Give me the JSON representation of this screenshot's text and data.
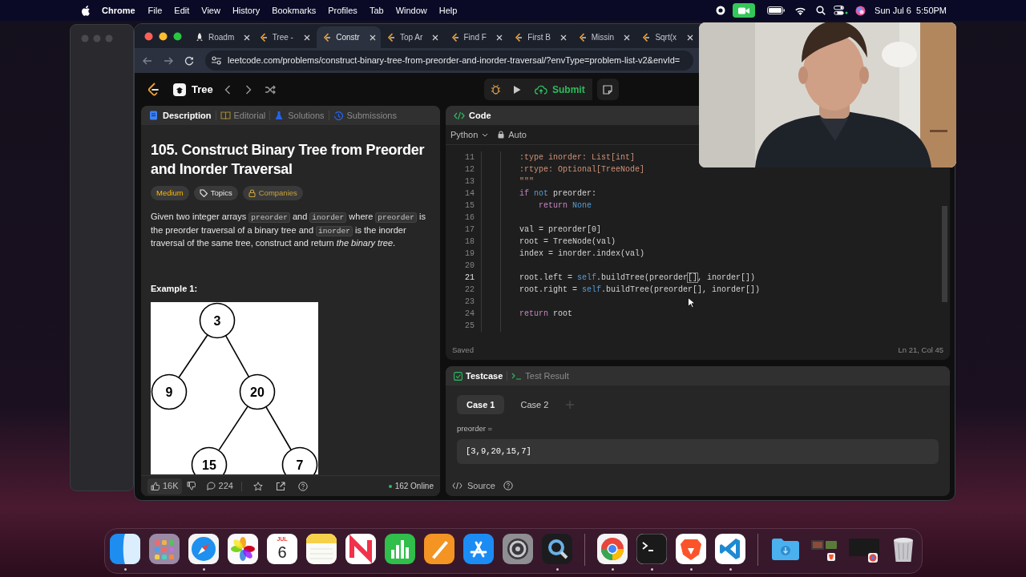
{
  "menu_bar": {
    "app": "Chrome",
    "menus": [
      "File",
      "Edit",
      "View",
      "History",
      "Bookmarks",
      "Profiles",
      "Tab",
      "Window",
      "Help"
    ],
    "clock": "Sun Jul 6  5:50PM"
  },
  "browser": {
    "tabs": [
      {
        "title": "Roadm",
        "selected": false,
        "kind": "rocket"
      },
      {
        "title": "Tree -",
        "selected": false,
        "kind": "leetcode"
      },
      {
        "title": "Constr",
        "selected": true,
        "kind": "leetcode"
      },
      {
        "title": "Top Ar",
        "selected": false,
        "kind": "leetcode"
      },
      {
        "title": "Find F",
        "selected": false,
        "kind": "leetcode"
      },
      {
        "title": "First B",
        "selected": false,
        "kind": "leetcode"
      },
      {
        "title": "Missin",
        "selected": false,
        "kind": "leetcode"
      },
      {
        "title": "Sqrt(x",
        "selected": false,
        "kind": "leetcode"
      }
    ],
    "url": "leetcode.com/problems/construct-binary-tree-from-preorder-and-inorder-traversal/?envType=problem-list-v2&envId="
  },
  "nav": {
    "list_title": "Tree",
    "submit": "Submit"
  },
  "description_panel": {
    "tabs": [
      {
        "label": "Description",
        "selected": true,
        "kind": "description"
      },
      {
        "label": "Editorial",
        "selected": false,
        "kind": "editorial"
      },
      {
        "label": "Solutions",
        "selected": false,
        "kind": "solutions"
      },
      {
        "label": "Submissions",
        "selected": false,
        "kind": "submissions"
      }
    ],
    "title": "105. Construct Binary Tree from Preorder and Inorder Traversal",
    "tags": [
      {
        "label": "Medium",
        "kind": "difficulty"
      },
      {
        "label": "Topics",
        "kind": "topics"
      },
      {
        "label": "Companies",
        "kind": "companies"
      }
    ],
    "statement": [
      {
        "text": "Given two integer arrays ",
        "kind": "text"
      },
      {
        "text": "preorder",
        "kind": "code"
      },
      {
        "text": " and ",
        "kind": "text"
      },
      {
        "text": "inorder",
        "kind": "code"
      },
      {
        "text": " where ",
        "kind": "text"
      },
      {
        "text": "preorder",
        "kind": "code"
      },
      {
        "text": " is the preorder traversal of a binary tree and ",
        "kind": "text"
      },
      {
        "text": "inorder",
        "kind": "code"
      },
      {
        "text": " is the inorder traversal of the same tree, construct and return *the binary tree*.",
        "kind": "text"
      }
    ],
    "example_heading": "Example 1:",
    "tree_nodes": [
      "3",
      "9",
      "20",
      "15",
      "7"
    ],
    "likes": "16K",
    "comments": "224",
    "online": "162 Online"
  },
  "code_panel": {
    "title": "Code",
    "language": "Python",
    "mode": "Auto",
    "lines": [
      {
        "number": "11",
        "active": false,
        "tokens": [
          {
            "text": "        :type inorder: List[int]",
            "kind": "doc"
          }
        ]
      },
      {
        "number": "12",
        "active": false,
        "tokens": [
          {
            "text": "        :rtype: Optional[TreeNode]",
            "kind": "doc"
          }
        ]
      },
      {
        "number": "13",
        "active": false,
        "tokens": [
          {
            "text": "        \"\"\"",
            "kind": "doc"
          }
        ]
      },
      {
        "number": "14",
        "active": false,
        "tokens": [
          {
            "text": "        if",
            "kind": "ctrl"
          },
          {
            "text": " not",
            "kind": "kw"
          },
          {
            "text": " preorder:",
            "kind": "plain"
          }
        ]
      },
      {
        "number": "15",
        "active": false,
        "tokens": [
          {
            "text": "            return",
            "kind": "ctrl"
          },
          {
            "text": " None",
            "kind": "kw"
          }
        ]
      },
      {
        "number": "16",
        "active": false
      },
      {
        "number": "17",
        "active": false,
        "tokens": [
          {
            "text": "        val = preorder[0]",
            "kind": "plain"
          }
        ]
      },
      {
        "number": "18",
        "active": false,
        "tokens": [
          {
            "text": "        root = TreeNode(val)",
            "kind": "plain"
          }
        ]
      },
      {
        "number": "19",
        "active": false,
        "tokens": [
          {
            "text": "        index = inorder.index(val)",
            "kind": "plain"
          }
        ]
      },
      {
        "number": "20",
        "active": false
      },
      {
        "number": "21",
        "active": true,
        "tokens": [
          {
            "text": "        root.left =",
            "kind": "plain"
          },
          {
            "text": " self",
            "kind": "kw"
          },
          {
            "text": ".buildTree(preorder",
            "kind": "plain"
          },
          {
            "text": "[]",
            "kind": "match"
          },
          {
            "text": ", inorder[])",
            "kind": "plain"
          }
        ]
      },
      {
        "number": "22",
        "active": false,
        "tokens": [
          {
            "text": "        root.right =",
            "kind": "plain"
          },
          {
            "text": " self",
            "kind": "kw"
          },
          {
            "text": ".buildTree(preorder[], inorder[])",
            "kind": "plain"
          }
        ]
      },
      {
        "number": "23",
        "active": false
      },
      {
        "number": "24",
        "active": false,
        "tokens": [
          {
            "text": "        return",
            "kind": "ctrl"
          },
          {
            "text": " root",
            "kind": "plain"
          }
        ]
      },
      {
        "number": "25",
        "active": false
      }
    ],
    "status": "Saved",
    "cursor": "Ln 21, Col 45"
  },
  "testcase_panel": {
    "tabs": [
      {
        "label": "Testcase",
        "selected": true,
        "kind": "testcase"
      },
      {
        "label": "Test Result",
        "selected": false,
        "kind": "result"
      }
    ],
    "cases": [
      {
        "label": "Case 1",
        "selected": true
      },
      {
        "label": "Case 2",
        "selected": false
      }
    ],
    "param_label": "preorder =",
    "param_value": "[3,9,20,15,7]",
    "source": "Source"
  },
  "dock": [
    {
      "kind": "finder",
      "running": true
    },
    {
      "kind": "launchpad",
      "running": false
    },
    {
      "kind": "safari",
      "running": true
    },
    {
      "kind": "photos",
      "running": false
    },
    {
      "kind": "calendar",
      "month": "JUL",
      "day": "6",
      "running": false
    },
    {
      "kind": "notes",
      "running": false
    },
    {
      "kind": "news",
      "running": false
    },
    {
      "kind": "numbers",
      "running": false
    },
    {
      "kind": "pages",
      "running": false
    },
    {
      "kind": "appstore",
      "running": false
    },
    {
      "kind": "settings",
      "running": false
    },
    {
      "kind": "quicktime",
      "running": true
    },
    {
      "kind": "separator"
    },
    {
      "kind": "chrome",
      "running": true
    },
    {
      "kind": "terminal",
      "running": true
    },
    {
      "kind": "brave",
      "running": true
    },
    {
      "kind": "vscode",
      "running": true
    },
    {
      "kind": "separator"
    },
    {
      "kind": "downloads",
      "running": false
    },
    {
      "kind": "window_thumbs",
      "running": false
    },
    {
      "kind": "window_dark",
      "running": false
    },
    {
      "kind": "trash",
      "running": false
    }
  ]
}
